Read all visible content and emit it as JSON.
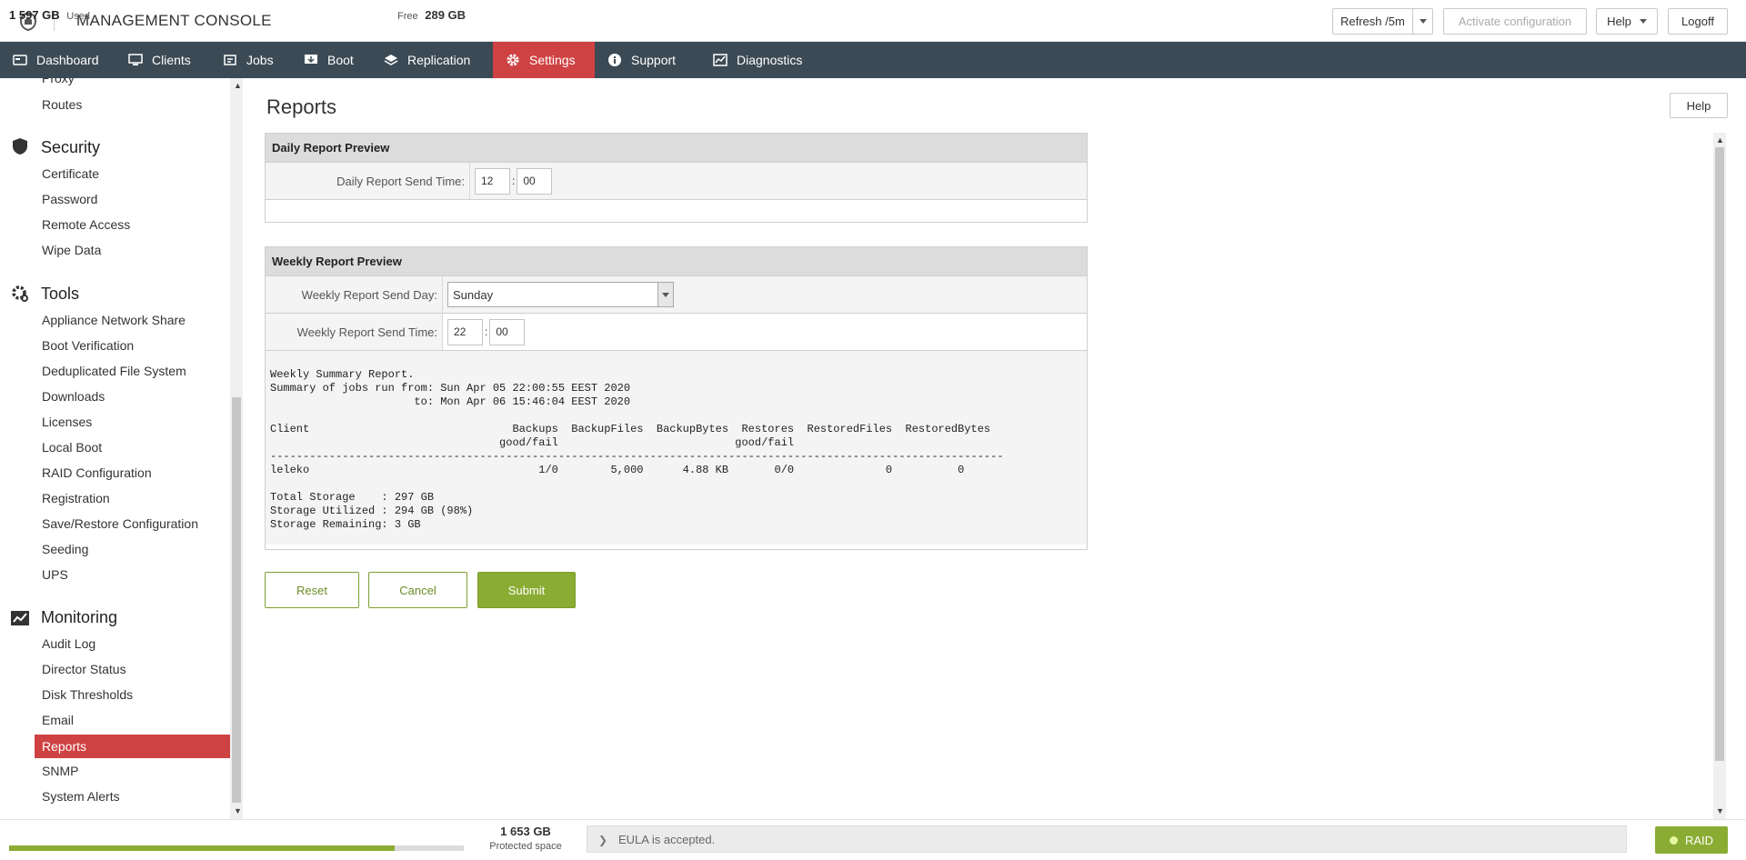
{
  "header": {
    "title": "MANAGEMENT CONSOLE",
    "refresh_label": "Refresh /5m",
    "activate_label": "Activate configuration",
    "help_label": "Help",
    "logoff_label": "Logoff"
  },
  "nav": {
    "items": [
      {
        "label": "Dashboard",
        "icon": "dashboard-icon"
      },
      {
        "label": "Clients",
        "icon": "monitor-icon"
      },
      {
        "label": "Jobs",
        "icon": "jobs-icon"
      },
      {
        "label": "Boot",
        "icon": "boot-icon"
      },
      {
        "label": "Replication",
        "icon": "layers-icon"
      },
      {
        "label": "Settings",
        "icon": "gear-icon",
        "active": true
      },
      {
        "label": "Support",
        "icon": "info-icon"
      },
      {
        "label": "Diagnostics",
        "icon": "chart-icon"
      }
    ]
  },
  "sidebar": {
    "network_items": [
      "Proxy",
      "Routes"
    ],
    "security": {
      "title": "Security",
      "items": [
        "Certificate",
        "Password",
        "Remote Access",
        "Wipe Data"
      ]
    },
    "tools": {
      "title": "Tools",
      "items": [
        "Appliance Network Share",
        "Boot Verification",
        "Deduplicated File System",
        "Downloads",
        "Licenses",
        "Local Boot",
        "RAID Configuration",
        "Registration",
        "Save/Restore Configuration",
        "Seeding",
        "UPS"
      ]
    },
    "monitoring": {
      "title": "Monitoring",
      "items": [
        "Audit Log",
        "Director Status",
        "Disk Thresholds",
        "Email",
        "Reports",
        "SNMP",
        "System Alerts"
      ],
      "active": "Reports"
    }
  },
  "main": {
    "title": "Reports",
    "help_label": "Help",
    "daily": {
      "header": "Daily Report Preview",
      "send_time_label": "Daily Report Send Time:",
      "hour": "12",
      "minute": "00"
    },
    "weekly": {
      "header": "Weekly Report Preview",
      "send_day_label": "Weekly Report Send Day:",
      "send_day": "Sunday",
      "send_time_label": "Weekly Report Send Time:",
      "hour": "22",
      "minute": "00",
      "report_text": "Weekly Summary Report.\nSummary of jobs run from: Sun Apr 05 22:00:55 EEST 2020\n                      to: Mon Apr 06 15:46:04 EEST 2020\n\nClient                               Backups  BackupFiles  BackupBytes  Restores  RestoredFiles  RestoredBytes\n                                   good/fail                           good/fail\n----------------------------------------------------------------------------------------------------------------\nleleko                                   1/0        5,000      4.88 KB       0/0              0          0\n\nTotal Storage    : 297 GB\nStorage Utilized : 294 GB (98%)\nStorage Remaining: 3 GB"
    },
    "buttons": {
      "reset": "Reset",
      "cancel": "Cancel",
      "submit": "Submit"
    }
  },
  "footer": {
    "used_value": "1 597 GB",
    "used_label": "Used",
    "free_label": "Free",
    "free_value": "289 GB",
    "used_fraction": 0.847,
    "protected_value": "1 653 GB",
    "protected_label": "Protected space",
    "eula_text": "EULA is accepted.",
    "raid_label": "RAID"
  },
  "colors": {
    "accent_red": "#cf4243",
    "accent_green": "#8aac33",
    "nav_bg": "#3c4a55"
  }
}
